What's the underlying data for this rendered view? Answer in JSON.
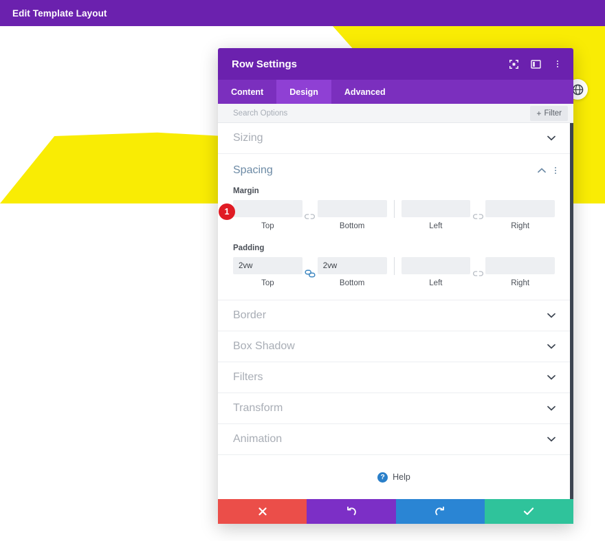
{
  "adminbar": {
    "title": "Edit Template Layout",
    "bg": "#6b21ae"
  },
  "page": {
    "accent_yellow": "#f9ec04",
    "background": "#ffffff"
  },
  "preview_button": {
    "icon": "globe-preview-icon"
  },
  "modal": {
    "title": "Row Settings",
    "header_icons": [
      {
        "name": "focus-target-icon",
        "label": "Focus"
      },
      {
        "name": "panel-layout-icon",
        "label": "Layout"
      },
      {
        "name": "more-options-icon",
        "label": "More"
      }
    ],
    "tabs": [
      {
        "label": "Content",
        "active": false
      },
      {
        "label": "Design",
        "active": true
      },
      {
        "label": "Advanced",
        "active": false
      }
    ],
    "search": {
      "placeholder": "Search Options",
      "value": ""
    },
    "filter": {
      "label": "Filter",
      "plus": "+"
    },
    "sections": [
      {
        "label": "Sizing",
        "open": false
      },
      {
        "label": "Spacing",
        "open": true
      },
      {
        "label": "Border",
        "open": false
      },
      {
        "label": "Box Shadow",
        "open": false
      },
      {
        "label": "Filters",
        "open": false
      },
      {
        "label": "Transform",
        "open": false
      },
      {
        "label": "Animation",
        "open": false
      }
    ],
    "spacing": {
      "title": "Spacing",
      "badge": "1",
      "margin": {
        "label": "Margin",
        "linked_top_bottom": false,
        "linked_left_right": false,
        "fields": [
          {
            "caption": "Top",
            "value": "",
            "placeholder": ""
          },
          {
            "caption": "Bottom",
            "value": "",
            "placeholder": ""
          },
          {
            "caption": "Left",
            "value": "",
            "placeholder": ""
          },
          {
            "caption": "Right",
            "value": "",
            "placeholder": ""
          }
        ]
      },
      "padding": {
        "label": "Padding",
        "linked_top_bottom": true,
        "linked_left_right": false,
        "fields": [
          {
            "caption": "Top",
            "value": "2vw",
            "placeholder": ""
          },
          {
            "caption": "Bottom",
            "value": "2vw",
            "placeholder": ""
          },
          {
            "caption": "Left",
            "value": "",
            "placeholder": ""
          },
          {
            "caption": "Right",
            "value": "",
            "placeholder": ""
          }
        ]
      }
    },
    "help": {
      "label": "Help",
      "icon": "question-mark-icon"
    },
    "footer": [
      {
        "name": "cancel-button",
        "icon": "close-icon",
        "color": "#eb4e49"
      },
      {
        "name": "undo-button",
        "icon": "undo-icon",
        "color": "#7c2fc6"
      },
      {
        "name": "redo-button",
        "icon": "redo-icon",
        "color": "#2a85d4"
      },
      {
        "name": "save-button",
        "icon": "check-icon",
        "color": "#2fc39b"
      }
    ]
  }
}
